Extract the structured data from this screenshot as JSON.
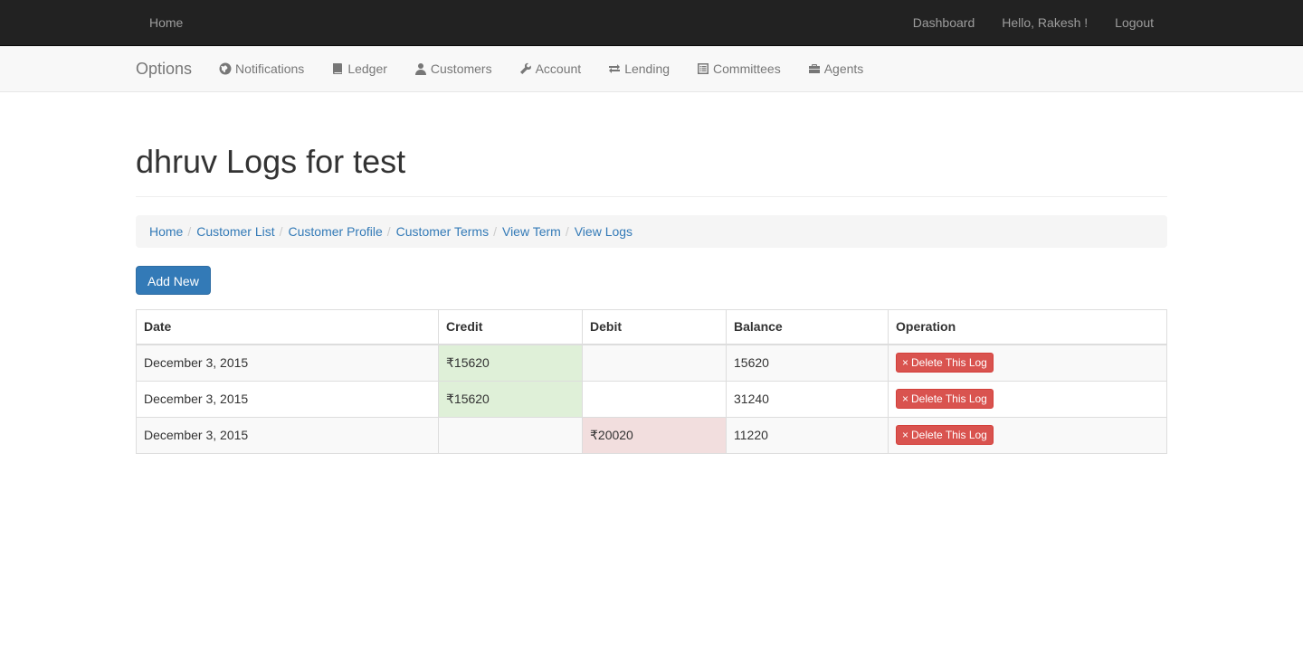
{
  "topnav": {
    "home": "Home",
    "dashboard": "Dashboard",
    "greeting": "Hello, Rakesh !",
    "logout": "Logout"
  },
  "subnav": {
    "brand": "Options",
    "items": [
      {
        "label": "Notifications",
        "icon": "globe-icon"
      },
      {
        "label": "Ledger",
        "icon": "book-icon"
      },
      {
        "label": "Customers",
        "icon": "user-icon"
      },
      {
        "label": "Account",
        "icon": "wrench-icon"
      },
      {
        "label": "Lending",
        "icon": "transfer-icon"
      },
      {
        "label": "Committees",
        "icon": "list-alt-icon"
      },
      {
        "label": "Agents",
        "icon": "briefcase-icon"
      }
    ]
  },
  "page": {
    "title": "dhruv Logs for test"
  },
  "breadcrumb": [
    "Home",
    "Customer List",
    "Customer Profile",
    "Customer Terms",
    "View Term",
    "View Logs"
  ],
  "actions": {
    "add_new": "Add New"
  },
  "table": {
    "headers": [
      "Date",
      "Credit",
      "Debit",
      "Balance",
      "Operation"
    ],
    "rows": [
      {
        "date": "December 3, 2015",
        "credit": "₹15620",
        "debit": "",
        "balance": "15620",
        "operation": "Delete This Log"
      },
      {
        "date": "December 3, 2015",
        "credit": "₹15620",
        "debit": "",
        "balance": "31240",
        "operation": "Delete This Log"
      },
      {
        "date": "December 3, 2015",
        "credit": "",
        "debit": "₹20020",
        "balance": "11220",
        "operation": "Delete This Log"
      }
    ]
  },
  "colors": {
    "navbar": "#222222",
    "primary": "#337ab7",
    "danger": "#d9534f",
    "success_cell": "#dff0d8",
    "danger_cell": "#f2dede"
  }
}
